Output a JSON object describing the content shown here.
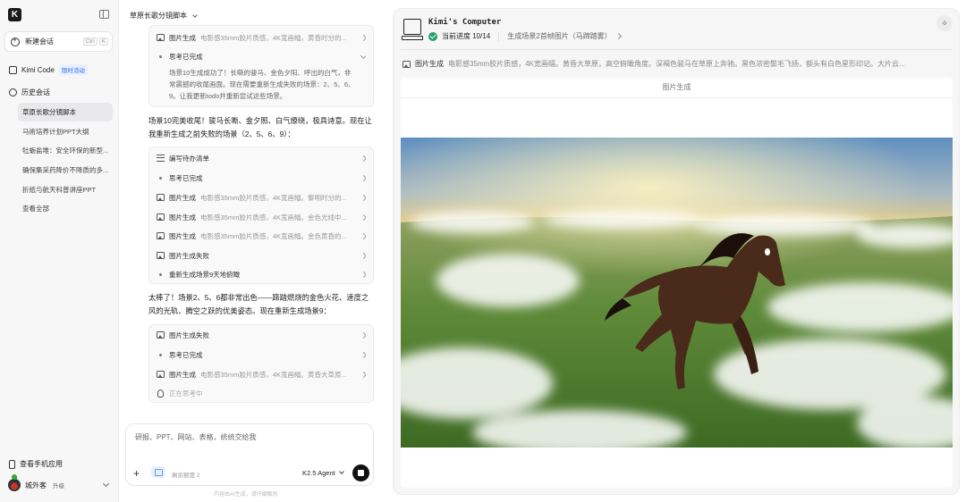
{
  "sidebar": {
    "logo": "K",
    "new_chat_label": "新建会话",
    "new_chat_shortcut": [
      "Ctrl",
      "K"
    ],
    "kimi_code_label": "Kimi Code",
    "kimi_code_badge": "限时活动",
    "history_label": "历史会话",
    "history_items": [
      "草原长歌分镜脚本",
      "马術培养计划PPT大纲",
      "牡蛎盐堆：安全环保的新型...",
      "确保集采药降价不降质的多...",
      "折纸与航天科普讲座PPT",
      "查看全部"
    ],
    "mobile_app_label": "查看手机应用",
    "user_name": "城外客",
    "user_upgrade": "升级"
  },
  "chat": {
    "title": "草原长歌分镜脚本",
    "block1": {
      "step_img_label": "图片生成",
      "step_img_desc": "电影感35mm胶片质感，4K宽画幅，黄昏时分的...",
      "step_think_label": "思考已完成",
      "thought": "场景10生成成功了！长嘶的骏马、金色夕阳、呼出的白气，非常震撼的收尾画面。现在需要重新生成失败的场景：2、5、6、9。让我更新todo并重新尝试这些场景。"
    },
    "para1": "场景10完美收尾！骏马长嘶、金夕照、白气缭绕，极具诗意。现在让我重新生成之前失败的场景（2、5、6、9）：",
    "block2": [
      {
        "label": "编写待办清单",
        "desc": ""
      },
      {
        "label": "思考已完成",
        "desc": ""
      },
      {
        "label": "图片生成",
        "desc": "电影感35mm胶片质感，4K宽画幅。黎明时分的..."
      },
      {
        "label": "图片生成",
        "desc": "电影感35mm胶片质感，4K宽画幅。金色光线中..."
      },
      {
        "label": "图片生成",
        "desc": "电影感35mm胶片质感，4K宽画幅。金色黄昏的..."
      },
      {
        "label": "图片生成失败",
        "desc": ""
      },
      {
        "label": "重新生成场景9天地俯瞰",
        "desc": ""
      }
    ],
    "para2": "太棒了！场景2、5、6都非常出色——蹄踏燃烧的金色火花、速度之风的光轨、腾空之跃的优美姿态。现在重新生成场景9：",
    "block3": [
      {
        "label": "图片生成失败",
        "desc": ""
      },
      {
        "label": "思考已完成",
        "desc": ""
      },
      {
        "label": "图片生成",
        "desc": "电影感35mm胶片质感，4K宽画幅。黄昏大草原..."
      },
      {
        "label": "正在思考中",
        "desc": ""
      }
    ],
    "input_placeholder": "研报、PPT、网站、表格，统统交给我",
    "tool_label": "剩余额度 2",
    "agent_label": "K2.5 Agent",
    "footnote": "内容由AI生成，请仔细甄别"
  },
  "computer": {
    "title": "Kimi's Computer",
    "progress_label": "当前进度 10/14",
    "current_task": "生成场景2首帧图片（马蹄踏雾）",
    "cmd_label": "图片生成",
    "cmd_desc": "电影感35mm胶片质感，4K宽画幅。黄昏大草原，高空俯瞰角度。深褐色骏马在草原上奔驰。黑色浓密鬃毛飞扬，额头有白色星形印记。大片云...",
    "viewer_title": "图片生成",
    "pin_icon": "✧"
  }
}
